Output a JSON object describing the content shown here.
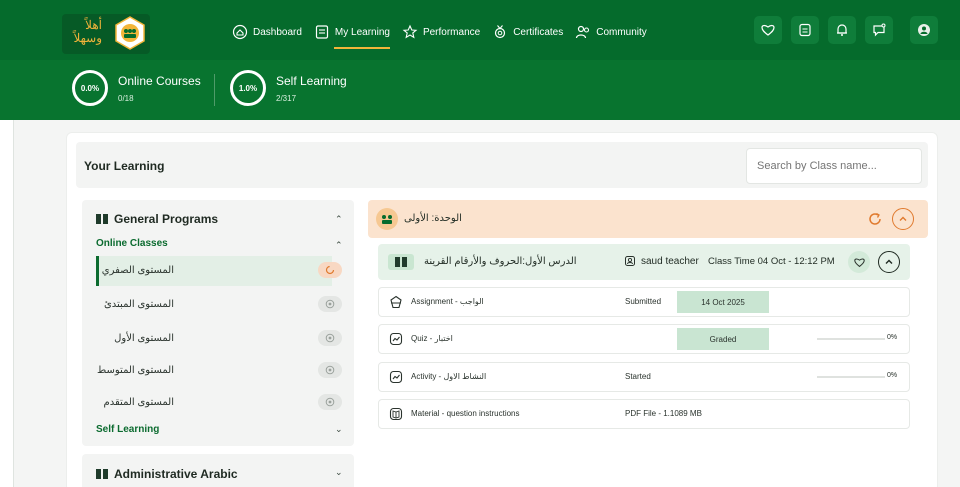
{
  "brand": {
    "logo_text": "أهلاً وسهلاً"
  },
  "nav": [
    {
      "label": "Dashboard",
      "icon": "home-icon"
    },
    {
      "label": "My Learning",
      "icon": "notebook-icon"
    },
    {
      "label": "Performance",
      "icon": "star-icon"
    },
    {
      "label": "Certificates",
      "icon": "medal-icon"
    },
    {
      "label": "Community",
      "icon": "users-icon"
    }
  ],
  "header_icons": [
    "heart-icon",
    "document-icon",
    "bell-icon",
    "chat-icon",
    "profile-icon"
  ],
  "stats": [
    {
      "percent": "0.0%",
      "label": "Online Courses",
      "count": "0/18"
    },
    {
      "percent": "1.0%",
      "label": "Self Learning",
      "count": "2/317"
    }
  ],
  "learning": {
    "title": "Your Learning",
    "search_placeholder": "Search by Class name..."
  },
  "sidebar": {
    "general_programs": "General Programs",
    "online_classes": "Online Classes",
    "levels": [
      {
        "name": "المستوى الصفري",
        "active": true
      },
      {
        "name": "المستوى المبتدئ",
        "active": false
      },
      {
        "name": "المستوى الأول",
        "active": false
      },
      {
        "name": "المستوى المتوسط",
        "active": false
      },
      {
        "name": "المستوى المتقدم",
        "active": false
      }
    ],
    "self_learning": "Self Learning",
    "administrative": "Administrative Arabic"
  },
  "unit": {
    "title": "الوحدة: الأولى"
  },
  "lesson": {
    "title": "الدرس الأول:الحروف والأرقام القرينة",
    "teacher": "saud teacher",
    "class_time": "Class Time 04 Oct - 12:12 PM"
  },
  "activities": [
    {
      "name": "Assignment - الواجب",
      "icon": "assignment-icon",
      "status": "Submitted",
      "pill": "14 Oct 2025",
      "progress": null,
      "percent": ""
    },
    {
      "name": "Quiz - اختبار",
      "icon": "quiz-icon",
      "status": "",
      "pill": "Graded",
      "progress": 0,
      "percent": "0%"
    },
    {
      "name": "Activity - النشاط الاول",
      "icon": "activity-icon",
      "status": "Started",
      "pill": "",
      "progress": 0,
      "percent": "0%"
    },
    {
      "name": "Material - question instructions",
      "icon": "material-icon",
      "status": "PDF File - 1.1089 MB",
      "pill": "",
      "progress": null,
      "percent": ""
    }
  ],
  "colors": {
    "primary": "#056b2c",
    "accent": "#f2b53a",
    "unit_bg": "#fbe3ce",
    "lesson_bg": "#e6f2e9"
  }
}
